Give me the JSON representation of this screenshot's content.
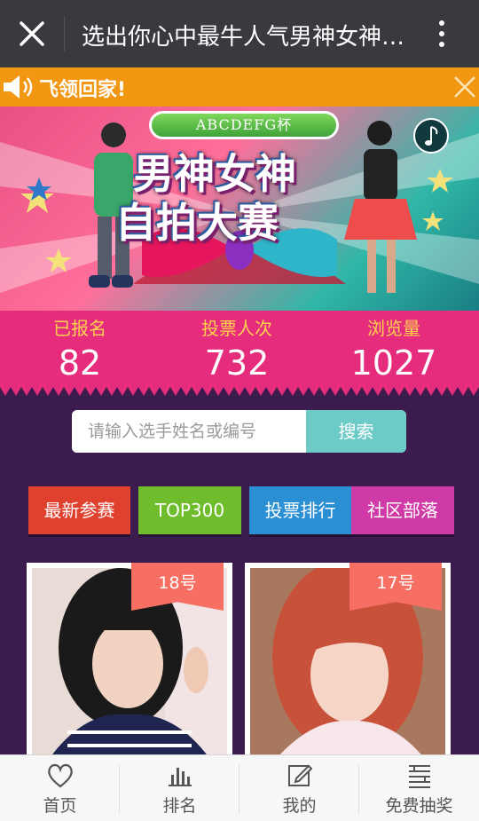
{
  "titlebar": {
    "title": "选出你心中最牛人气男神女神…"
  },
  "notice": {
    "text": "飞领回家!"
  },
  "banner": {
    "cup_text": "ABCDEFG杯",
    "title_line1": "男神女神",
    "title_line2": "自拍大赛"
  },
  "stats": [
    {
      "label": "已报名",
      "value": "82"
    },
    {
      "label": "投票人次",
      "value": "732"
    },
    {
      "label": "浏览量",
      "value": "1027"
    }
  ],
  "search": {
    "placeholder": "请输入选手姓名或编号",
    "button": "搜索"
  },
  "nav_buttons": [
    {
      "label": "最新参赛",
      "color": "#e0412f"
    },
    {
      "label": "TOP300",
      "color": "#6fbd2c"
    },
    {
      "label": "投票排行",
      "color": "#2b8fd3"
    },
    {
      "label": "社区部落",
      "color": "#cf3aa7"
    }
  ],
  "contestants": [
    {
      "number": "18号"
    },
    {
      "number": "17号"
    }
  ],
  "tabbar": [
    {
      "label": "首页",
      "icon": "heart-icon"
    },
    {
      "label": "排名",
      "icon": "bar-chart-icon"
    },
    {
      "label": "我的",
      "icon": "edit-icon"
    },
    {
      "label": "免费抽奖",
      "icon": "gift-icon"
    }
  ]
}
